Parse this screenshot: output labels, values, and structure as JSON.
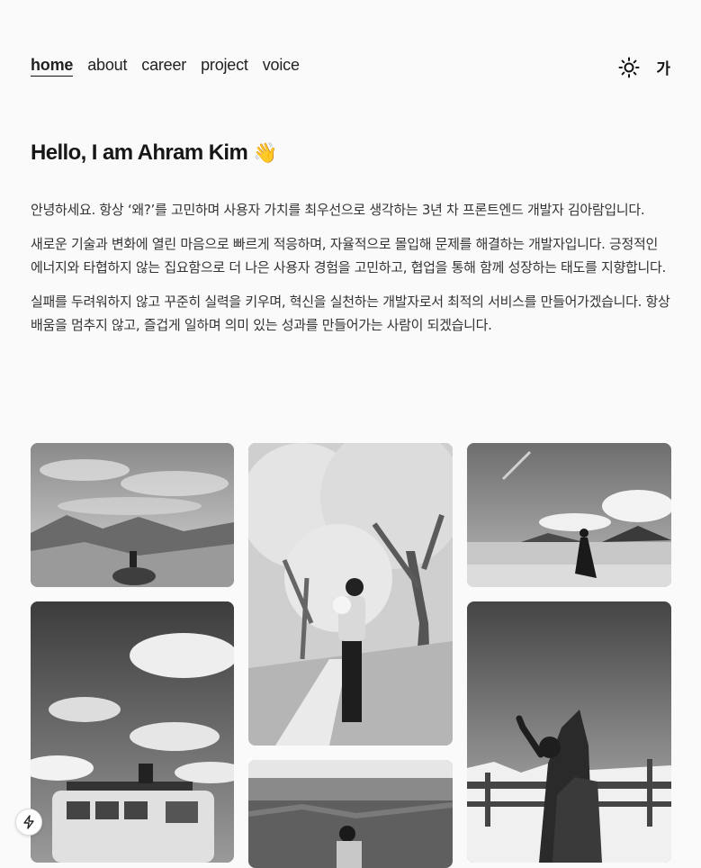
{
  "nav": {
    "items": [
      {
        "label": "home",
        "active": true
      },
      {
        "label": "about",
        "active": false
      },
      {
        "label": "career",
        "active": false
      },
      {
        "label": "project",
        "active": false
      },
      {
        "label": "voice",
        "active": false
      }
    ]
  },
  "tools": {
    "theme_icon": "sun-icon",
    "lang_label": "가"
  },
  "hero": {
    "title": "Hello, I am Ahram Kim",
    "emoji": "👋"
  },
  "intro": {
    "paragraphs": [
      "안녕하세요. 항상 ‘왜?’를 고민하며 사용자 가치를 최우선으로 생각하는 3년 차 프론트엔드 개발자 김아람입니다.",
      "새로운 기술과 변화에 열린 마음으로 빠르게 적응하며, 자율적으로 몰입해 문제를 해결하는 개발자입니다. 긍정적인 에너지와 타협하지 않는 집요함으로 더 나은 사용자 경험을 고민하고, 협업을 통해 함께 성장하는 태도를 지향합니다.",
      "실패를 두려워하지 않고 꾸준히 실력을 키우며, 혁신을 실천하는 개발자로서 최적의 서비스를 만들어가겠습니다. 항상 배움을 멈추지 않고, 즐겁게 일하며 의미 있는 성과를 만들어가는 사람이 되겠습니다."
    ]
  },
  "gallery": {
    "photos": [
      {
        "name": "photo-mountain-rocks"
      },
      {
        "name": "photo-cherry-blossom"
      },
      {
        "name": "photo-beach"
      },
      {
        "name": "photo-van-sky"
      },
      {
        "name": "photo-canyon"
      },
      {
        "name": "photo-monument-wave"
      }
    ]
  },
  "floating": {
    "icon": "bolt-icon"
  }
}
